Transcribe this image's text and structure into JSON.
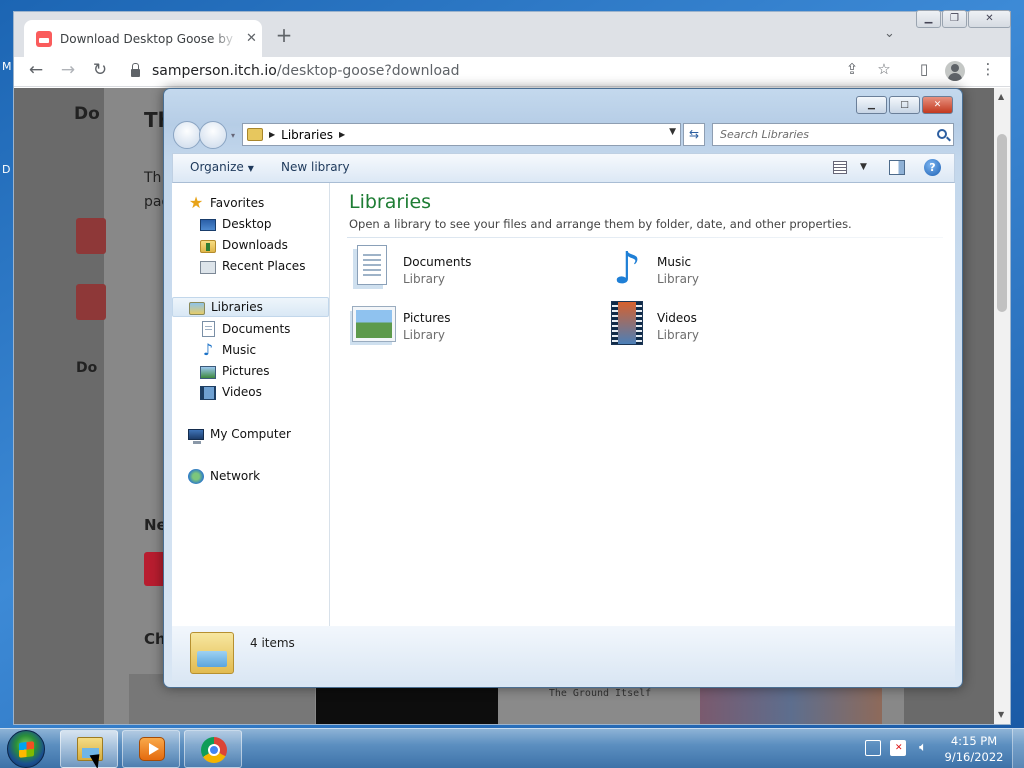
{
  "desktop": {
    "left_text_1": "M",
    "left_text_2": "D"
  },
  "browser": {
    "tab_title": "Download Desktop Goose by samperson",
    "tab_close": "✕",
    "new_tab": "+",
    "url_host": "samperson.itch.io",
    "url_path": "/desktop-goose?download",
    "window_controls": {
      "minimize": "▁",
      "restore": "❐",
      "close": "✕"
    },
    "page_partial_text": {
      "heading_left": "Do",
      "heading": "Th",
      "para_1": "Th",
      "para_2": "pag",
      "section_1": "Do",
      "section_2": "Ne",
      "section_3": "Ch",
      "thumb_caption": "The Ground Itself"
    }
  },
  "explorer": {
    "window_controls": {
      "minimize": "▁",
      "maximize": "□",
      "close": "✕"
    },
    "address_crumb": "Libraries",
    "search_placeholder": "Search Libraries",
    "toolbar": {
      "organize": "Organize",
      "new_library": "New library",
      "help": "?"
    },
    "nav": {
      "favorites": "Favorites",
      "desktop": "Desktop",
      "downloads": "Downloads",
      "recent_places": "Recent Places",
      "libraries": "Libraries",
      "documents": "Documents",
      "music": "Music",
      "pictures": "Pictures",
      "videos": "Videos",
      "my_computer": "My Computer",
      "network": "Network"
    },
    "heading": "Libraries",
    "description": "Open a library to see your files and arrange them by folder, date, and other properties.",
    "libraries": [
      {
        "name": "Documents",
        "type": "Library"
      },
      {
        "name": "Music",
        "type": "Library"
      },
      {
        "name": "Pictures",
        "type": "Library"
      },
      {
        "name": "Videos",
        "type": "Library"
      }
    ],
    "status": "4 items"
  },
  "taskbar": {
    "time": "4:15 PM",
    "date": "9/16/2022"
  }
}
